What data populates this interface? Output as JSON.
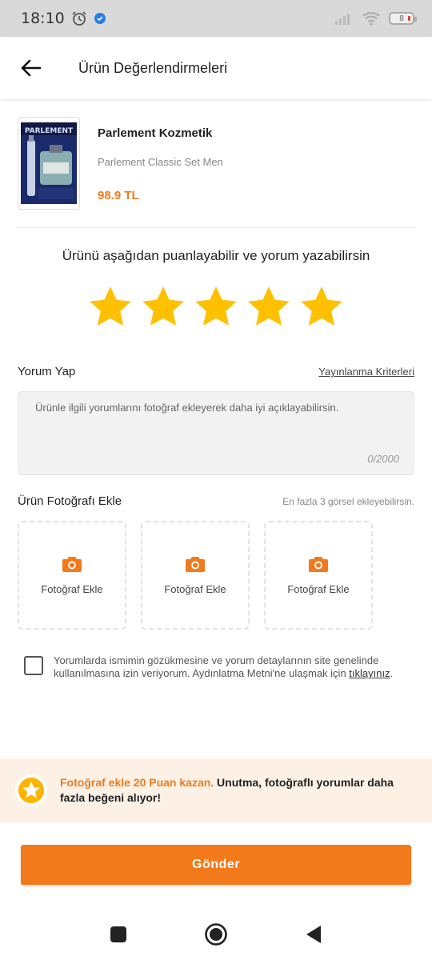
{
  "status_bar": {
    "time": "18:10",
    "battery_level": "8"
  },
  "header": {
    "title": "Ürün Değerlendirmeleri"
  },
  "product": {
    "brand": "Parlement Kozmetik",
    "name": "Parlement Classic Set Men",
    "price": "98.9 TL",
    "image_caption": "PARLEMENT"
  },
  "rating": {
    "prompt": "Ürünü aşağıdan puanlayabilir ve yorum yazabilirsin",
    "stars": 5,
    "max_stars": 5,
    "star_color": "#ffc000"
  },
  "comment": {
    "label": "Yorum Yap",
    "criteria_link": "Yayınlanma Kriterleri",
    "placeholder": "Ürünle ilgili yorumlarını fotoğraf ekleyerek daha iyi açıklayabilirsin.",
    "counter": "0/2000"
  },
  "photos": {
    "label": "Ürün Fotoğrafı Ekle",
    "hint": "En fazla 3 görsel ekleyebilirsin.",
    "slots": [
      {
        "label": "Fotoğraf Ekle",
        "icon": "camera-icon"
      },
      {
        "label": "Fotoğraf Ekle",
        "icon": "camera-icon"
      },
      {
        "label": "Fotoğraf Ekle",
        "icon": "camera-icon"
      }
    ]
  },
  "consent": {
    "text": "Yorumlarda ismimin gözükmesine ve yorum detaylarının site genelinde kullanılmasına izin veriyorum. Aydınlatma Metni'ne ulaşmak için ",
    "link": "tıklayınız",
    "suffix": "."
  },
  "banner": {
    "highlight": "Fotoğraf ekle 20 Puan kazan.",
    "text": " Unutma, fotoğraflı yorumlar daha fazla beğeni alıyor!"
  },
  "submit": {
    "label": "Gönder"
  },
  "colors": {
    "accent": "#f27a1a",
    "star": "#ffc000",
    "banner_bg": "#fdf1e6"
  }
}
